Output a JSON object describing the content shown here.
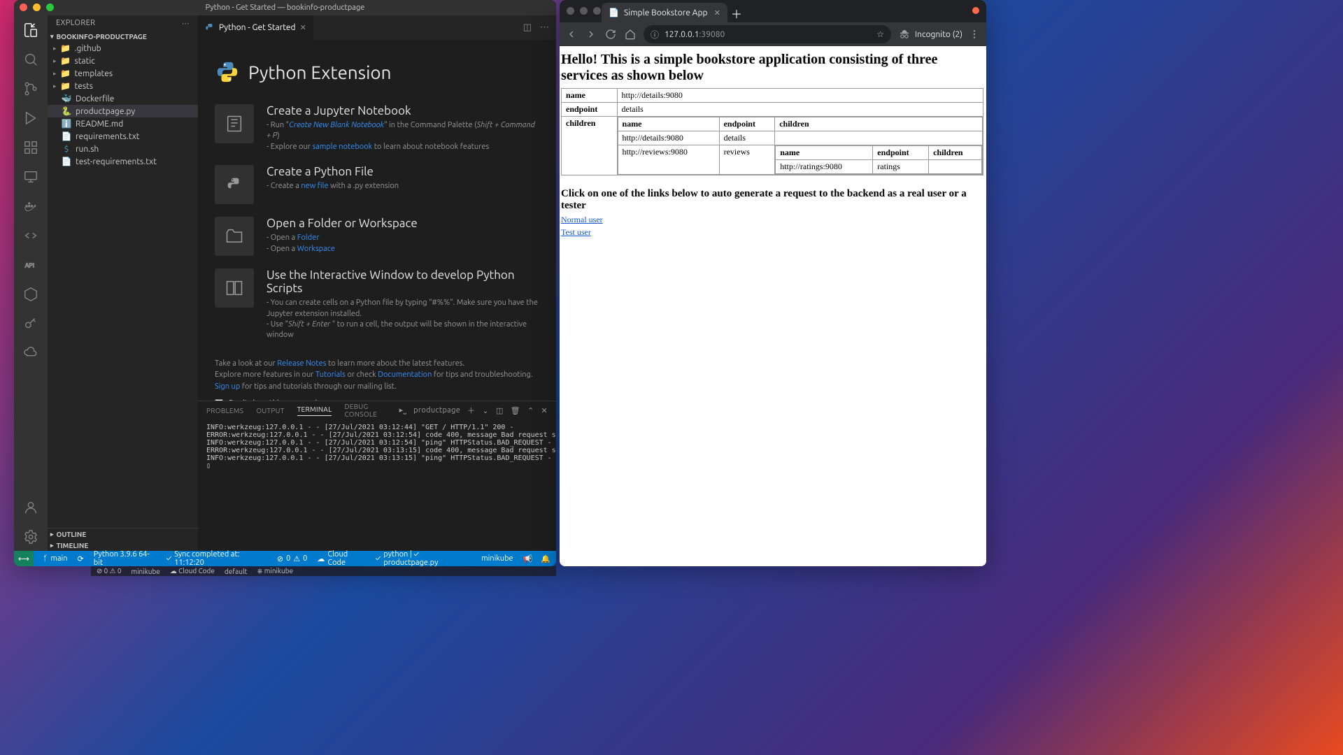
{
  "vscode": {
    "window_title": "Python - Get Started — bookinfo-productpage",
    "explorer_title": "EXPLORER",
    "workspace_name": "BOOKINFO-PRODUCTPAGE",
    "tree": [
      {
        "name": ".github",
        "kind": "folder"
      },
      {
        "name": "static",
        "kind": "folder"
      },
      {
        "name": "templates",
        "kind": "folder"
      },
      {
        "name": "tests",
        "kind": "folder"
      },
      {
        "name": "Dockerfile",
        "kind": "file",
        "icon": "docker"
      },
      {
        "name": "productpage.py",
        "kind": "file",
        "icon": "python",
        "selected": true
      },
      {
        "name": "README.md",
        "kind": "file",
        "icon": "info"
      },
      {
        "name": "requirements.txt",
        "kind": "file",
        "icon": "text"
      },
      {
        "name": "run.sh",
        "kind": "file",
        "icon": "shell"
      },
      {
        "name": "test-requirements.txt",
        "kind": "file",
        "icon": "text"
      }
    ],
    "outline_label": "OUTLINE",
    "timeline_label": "TIMELINE",
    "tab_label": "Python - Get Started",
    "extension": {
      "title": "Python Extension",
      "cards": [
        {
          "title": "Create a Jupyter Notebook",
          "l1a": "- Run \"",
          "l1link": "Create New Blank Notebook",
          "l1b": "\" in the Command Palette (",
          "l1kbd": "Shift + Command + P",
          "l1c": ")",
          "l2a": "- Explore our ",
          "l2link": "sample notebook",
          "l2b": " to learn about notebook features"
        },
        {
          "title": "Create a Python File",
          "l1a": "- Create a ",
          "l1link": "new file",
          "l1b": " with a .py extension"
        },
        {
          "title": "Open a Folder or Workspace",
          "l1a": "- Open a ",
          "l1link": "Folder",
          "l2a": "- Open a ",
          "l2link": "Workspace"
        },
        {
          "title": "Use the Interactive Window to develop Python Scripts",
          "l1": "- You can create cells on a Python file by typing \"#%%\". Make sure you have the Jupyter extension installed.",
          "l2a": "- Use \"",
          "l2kbd": "Shift + Enter",
          "l2b": " \" to run a cell, the output will be shown in the interactive window"
        }
      ],
      "notes": {
        "n1a": "Take a look at our ",
        "n1link": "Release Notes",
        "n1b": " to learn more about the latest features.",
        "n2a": "Explore more features in our ",
        "n2link1": "Tutorials",
        "n2mid": " or check ",
        "n2link2": "Documentation",
        "n2b": " for tips and troubleshooting.",
        "n3link": "Sign up",
        "n3b": " for tips and tutorials through our mailing list."
      },
      "dont_show": "Don't show this page again"
    },
    "panel": {
      "tabs": [
        "PROBLEMS",
        "OUTPUT",
        "TERMINAL",
        "DEBUG CONSOLE"
      ],
      "active_tab": "TERMINAL",
      "terminal_name": "productpage",
      "terminal_text": "INFO:werkzeug:127.0.0.1 - - [27/Jul/2021 03:12:44] \"GET / HTTP/1.1\" 200 -\nERROR:werkzeug:127.0.0.1 - - [27/Jul/2021 03:12:54] code 400, message Bad request syntax ('ping')\nINFO:werkzeug:127.0.0.1 - - [27/Jul/2021 03:12:54] \"ping\" HTTPStatus.BAD_REQUEST -\nERROR:werkzeug:127.0.0.1 - - [27/Jul/2021 03:13:15] code 400, message Bad request syntax ('ping')\nINFO:werkzeug:127.0.0.1 - - [27/Jul/2021 03:13:15] \"ping\" HTTPStatus.BAD_REQUEST -\n▯"
    },
    "statusbar": {
      "branch": "main",
      "interpreter": "Python 3.9.6 64-bit",
      "sync": "Sync completed at: 11:12:20",
      "warn0": "0",
      "err0": "0",
      "cloud_code": "Cloud Code",
      "lang_status": "python | ✓ productpage.py",
      "minikube": "minikube"
    },
    "menubar": {
      "items": [
        "⊘ 0 ⚠ 0",
        "minikube",
        "☁ Cloud Code",
        "default",
        "⎈ minikube"
      ]
    }
  },
  "chrome": {
    "tab_title": "Simple Bookstore App",
    "url_host": "127.0.0.1",
    "url_port": ":39080",
    "incognito_label": "Incognito (2)",
    "page": {
      "heading": "Hello! This is a simple bookstore application consisting of three services as shown below",
      "cols": [
        "name",
        "endpoint",
        "children"
      ],
      "root": {
        "name": "http://details:9080",
        "endpoint": "details"
      },
      "children": [
        {
          "name": "http://details:9080",
          "endpoint": "details",
          "children": []
        },
        {
          "name": "http://reviews:9080",
          "endpoint": "reviews",
          "children": [
            {
              "name": "http://ratings:9080",
              "endpoint": "ratings"
            }
          ]
        }
      ],
      "links_heading": "Click on one of the links below to auto generate a request to the backend as a real user or a tester",
      "links": [
        "Normal user",
        "Test user"
      ]
    }
  }
}
